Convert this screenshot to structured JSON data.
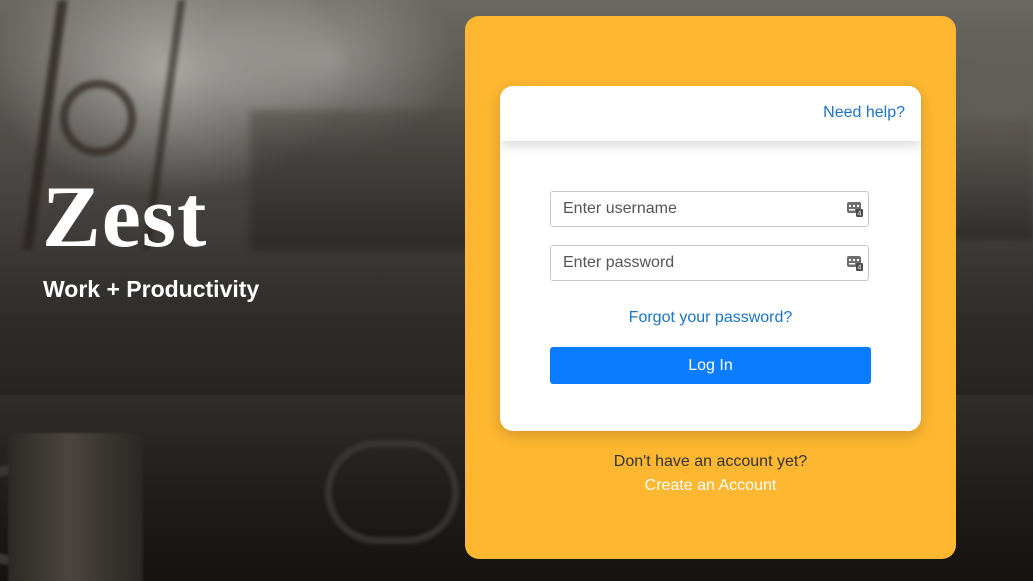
{
  "brand": {
    "title": "Zest",
    "tagline": "Work + Productivity"
  },
  "login": {
    "help_label": "Need help?",
    "username_placeholder": "Enter username",
    "username_value": "",
    "password_placeholder": "Enter password",
    "password_value": "",
    "field_icon": "password-manager-keypad-icon",
    "forgot_label": "Forgot your password?",
    "submit_label": "Log In",
    "signup_prompt": "Don't have an account yet?",
    "signup_label": "Create an Account"
  },
  "colors": {
    "panel_background": "#fdb731",
    "link_blue": "#1a73c9",
    "button_blue": "#0a7cff"
  }
}
